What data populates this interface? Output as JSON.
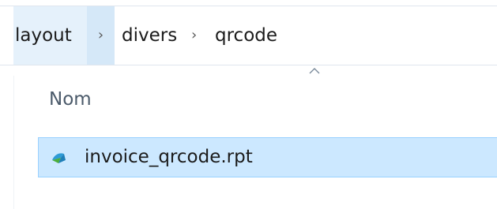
{
  "breadcrumb": {
    "items": [
      {
        "label": "layout"
      },
      {
        "label": "divers"
      },
      {
        "label": "qrcode"
      }
    ],
    "separator": "›"
  },
  "file_list": {
    "columns": [
      {
        "label": "Nom",
        "sort": "ascending"
      }
    ],
    "rows": [
      {
        "name": "invoice_qrcode.rpt",
        "icon": "crystal-report-file-icon",
        "selected": true
      }
    ]
  },
  "colors": {
    "selection_bg": "#cce8ff",
    "selection_border": "#99d1ff",
    "crumb_hover_bg": "#e5f1fb"
  }
}
